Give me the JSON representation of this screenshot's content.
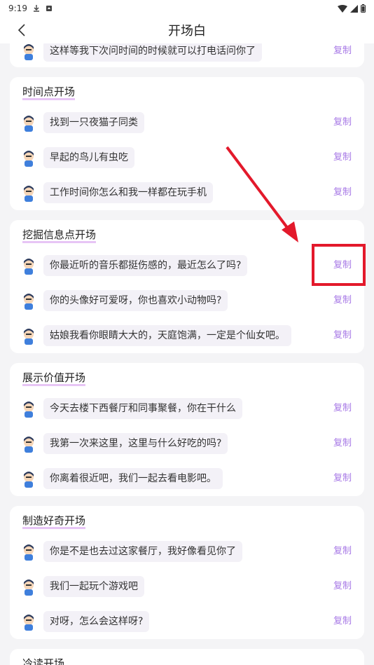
{
  "status": {
    "time": "9:19"
  },
  "header": {
    "title": "开场白"
  },
  "copy_label": "复制",
  "partial_top": {
    "text": "这样等我下次问时间的时候就可以打电话问你了"
  },
  "sections": [
    {
      "title": "时间点开场",
      "items": [
        "找到一只夜猫子同类",
        "早起的鸟儿有虫吃",
        "工作时间你怎么和我一样都在玩手机"
      ]
    },
    {
      "title": "挖掘信息点开场",
      "items": [
        "你最近听的音乐都挺伤感的，最近怎么了吗?",
        "你的头像好可爱呀，你也喜欢小动物吗?",
        "姑娘我看你眼睛大大的，天庭饱满，一定是个仙女吧。"
      ]
    },
    {
      "title": "展示价值开场",
      "items": [
        "今天去楼下西餐厅和同事聚餐，你在干什么",
        "我第一次来这里，这里与什么好吃的吗?",
        "你离着很近吧，我们一起去看电影吧。"
      ]
    },
    {
      "title": "制造好奇开场",
      "items": [
        "你是不是也去过这家餐厅，我好像看见你了",
        "我们一起玩个游戏吧",
        "对呀，怎么会这样呀?"
      ]
    },
    {
      "title": "冷读开场",
      "items": []
    }
  ],
  "colors": {
    "accent": "#a779e6",
    "highlight": "#e3192b",
    "title_underline": "#e7c5f5"
  }
}
